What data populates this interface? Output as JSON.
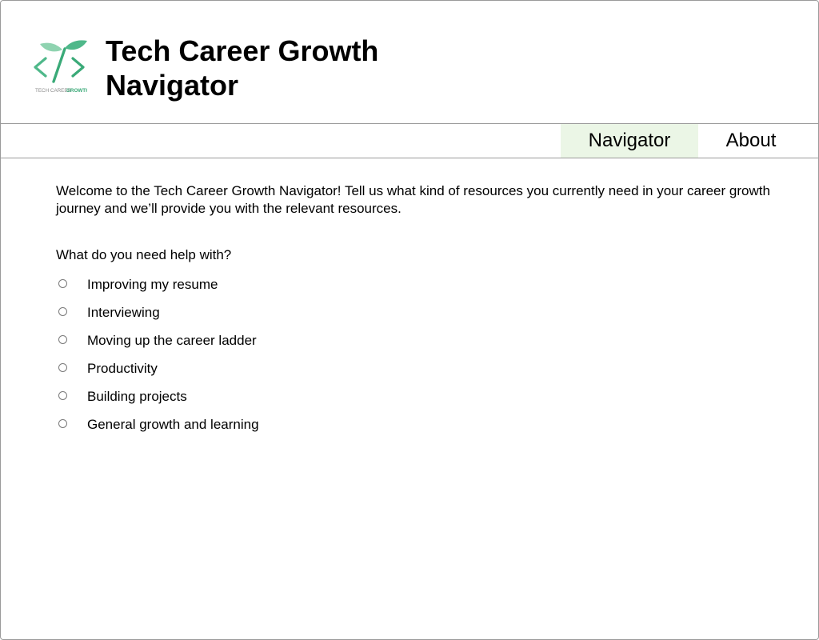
{
  "header": {
    "logo_text": "TECH CAREER GROWTH",
    "title": "Tech Career Growth Navigator"
  },
  "nav": {
    "tabs": [
      {
        "label": "Navigator",
        "active": true
      },
      {
        "label": "About",
        "active": false
      }
    ]
  },
  "main": {
    "welcome": "Welcome to the Tech Career Growth Navigator! Tell us what kind of resources you currently need in your career growth journey and we’ll provide you with the relevant resources.",
    "question": "What do you need help with?",
    "options": [
      "Improving my resume",
      "Interviewing",
      "Moving up the career ladder",
      "Productivity",
      "Building projects",
      "General growth and learning"
    ]
  },
  "colors": {
    "accent": "#3aaa78",
    "active_tab_bg": "#ebf6e6",
    "border": "#9a9a9a"
  },
  "icons": {
    "logo": "sprout-code-icon"
  }
}
